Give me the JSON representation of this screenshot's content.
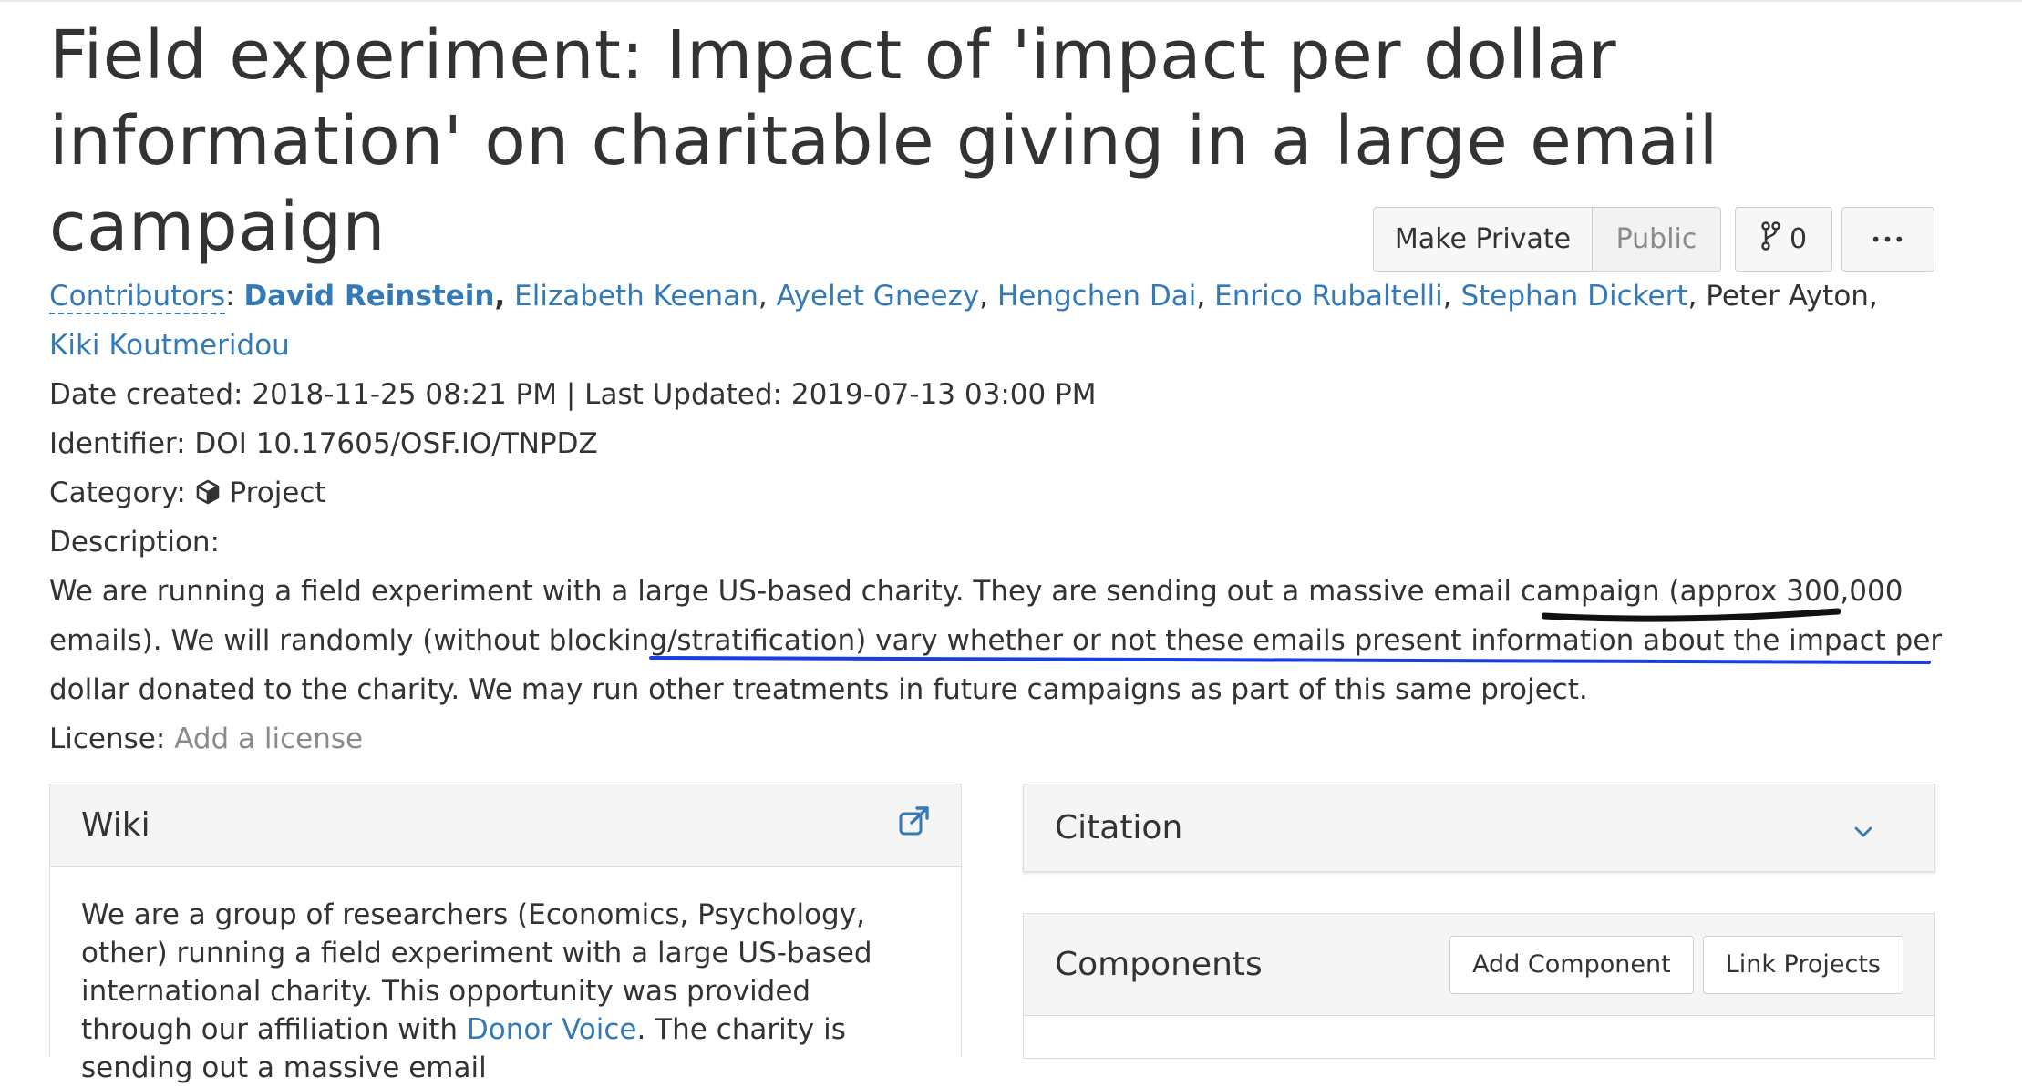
{
  "project": {
    "title": "Field experiment: Impact of 'impact per dollar information' on charitable giving in a large email campaign"
  },
  "actions": {
    "make_private": "Make Private",
    "public": "Public",
    "fork_count": "0",
    "more": "•••"
  },
  "contributors": {
    "label": "Contributors",
    "people": [
      {
        "name": "David Reinstein",
        "linked": true,
        "bold": true
      },
      {
        "name": "Elizabeth Keenan",
        "linked": true
      },
      {
        "name": "Ayelet Gneezy",
        "linked": true
      },
      {
        "name": "Hengchen Dai",
        "linked": true
      },
      {
        "name": "Enrico Rubaltelli",
        "linked": true
      },
      {
        "name": "Stephan Dickert",
        "linked": true
      },
      {
        "name": "Peter Ayton",
        "linked": false
      },
      {
        "name": "Kiki Koutmeridou",
        "linked": true
      }
    ]
  },
  "dates": {
    "created_label": "Date created:",
    "created": "2018-11-25 08:21 PM",
    "separator": "|",
    "updated_label": "Last Updated:",
    "updated": "2019-07-13 03:00 PM"
  },
  "identifier": {
    "label": "Identifier:",
    "value": "DOI 10.17605/OSF.IO/TNPDZ"
  },
  "category": {
    "label": "Category:",
    "icon": "cube-icon",
    "value": "Project"
  },
  "description": {
    "label": "Description:",
    "part1": "We are running a field experiment with a large US-based charity. They are sending out a massive email campaign (",
    "emphasis": "approx 300,000 emails",
    "part2": "). We will randomly (without blocking/stratification) ",
    "highlight": "vary whether or not these emails present information about the impact per dollar donated to the",
    "part3": " charity. We may run other treatments in future campaigns as part of this same project."
  },
  "license": {
    "label": "License:",
    "value": "Add a license"
  },
  "wiki": {
    "title": "Wiki",
    "text_before_link": "We are a group of researchers (Economics, Psychology, other) running a field experiment with a large US-based international charity. This opportunity was provided through our affiliation with ",
    "link_text": "Donor Voice",
    "text_after_link": ". The charity is sending out a massive email"
  },
  "citation": {
    "title": "Citation"
  },
  "components": {
    "title": "Components",
    "add_component": "Add Component",
    "link_projects": "Link Projects"
  },
  "colors": {
    "link": "#337ab7",
    "text": "#333333",
    "ink_black": "#111111",
    "ink_blue": "#1a3ee0"
  }
}
